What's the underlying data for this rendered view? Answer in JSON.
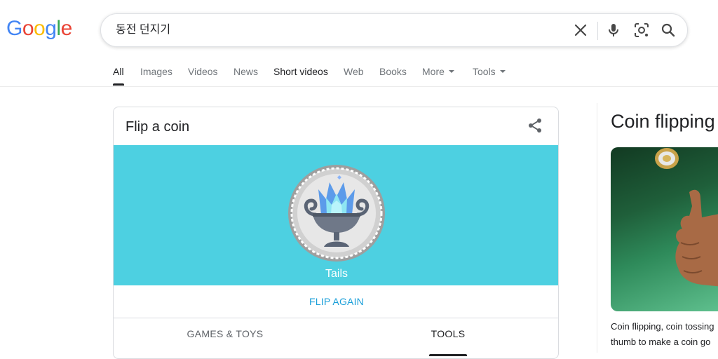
{
  "logo": {
    "letters": [
      "G",
      "o",
      "o",
      "g",
      "l",
      "e"
    ],
    "colors": [
      "#4285F4",
      "#EA4335",
      "#FBBC05",
      "#4285F4",
      "#34A853",
      "#EA4335"
    ]
  },
  "search": {
    "query": "동전 던지기"
  },
  "icons": {
    "clear": "close-icon",
    "voice": "microphone-icon",
    "lens": "camera-lens-icon",
    "search": "search-icon",
    "share": "share-icon"
  },
  "tabs": {
    "all": "All",
    "images": "Images",
    "videos": "Videos",
    "news": "News",
    "short_videos": "Short videos",
    "web": "Web",
    "books": "Books",
    "more": "More",
    "tools": "Tools"
  },
  "card": {
    "title": "Flip a coin",
    "result": "Tails",
    "flip_again": "FLIP AGAIN",
    "categories": [
      "GAMES & TOYS",
      "TOOLS"
    ],
    "active_category": "TOOLS",
    "accent": "#4dd0e1"
  },
  "knowledge_panel": {
    "title": "Coin flipping",
    "snippet_line1": "Coin flipping, coin tossing",
    "snippet_line2": "thumb to make a coin go"
  }
}
